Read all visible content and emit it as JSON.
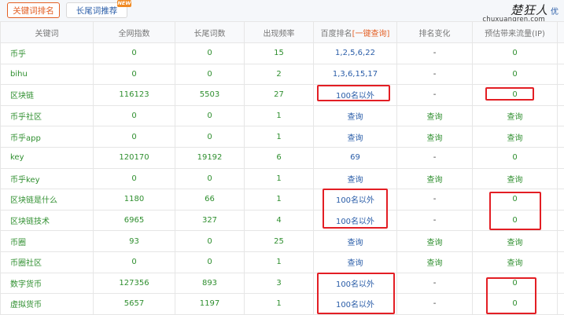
{
  "toolbar": {
    "tab_keywords_rank": "关键词排名",
    "tab_longtail": "长尾词推荐",
    "new_badge": "NEW"
  },
  "watermark": {
    "line1": "楚狂人",
    "line1_suffix": "优",
    "line2": "chuxuangren.com"
  },
  "table": {
    "headers": {
      "keyword": "关键词",
      "index": "全网指数",
      "longtail": "长尾词数",
      "freq": "出现频率",
      "baidu": "百度排名",
      "baidu_action": "[一键查询]",
      "change": "排名变化",
      "traffic": "预估带来流量(IP)"
    },
    "rows": [
      {
        "keyword": "币乎",
        "index": "0",
        "longtail": "0",
        "freq": "15",
        "baidu": "1,2,5,6,22",
        "change": "-",
        "traffic": "0"
      },
      {
        "keyword": "bihu",
        "index": "0",
        "longtail": "0",
        "freq": "2",
        "baidu": "1,3,6,15,17",
        "change": "-",
        "traffic": "0"
      },
      {
        "keyword": "区块链",
        "index": "116123",
        "longtail": "5503",
        "freq": "27",
        "baidu": "100名以外",
        "change": "-",
        "traffic": "0"
      },
      {
        "keyword": "币乎社区",
        "index": "0",
        "longtail": "0",
        "freq": "1",
        "baidu": "查询",
        "change": "查询",
        "traffic": "查询"
      },
      {
        "keyword": "币乎app",
        "index": "0",
        "longtail": "0",
        "freq": "1",
        "baidu": "查询",
        "change": "查询",
        "traffic": "查询"
      },
      {
        "keyword": "key",
        "index": "120170",
        "longtail": "19192",
        "freq": "6",
        "baidu": "69",
        "change": "-",
        "traffic": "0"
      },
      {
        "keyword": "币乎key",
        "index": "0",
        "longtail": "0",
        "freq": "1",
        "baidu": "查询",
        "change": "查询",
        "traffic": "查询"
      },
      {
        "keyword": "区块链是什么",
        "index": "1180",
        "longtail": "66",
        "freq": "1",
        "baidu": "100名以外",
        "change": "-",
        "traffic": "0"
      },
      {
        "keyword": "区块链技术",
        "index": "6965",
        "longtail": "327",
        "freq": "4",
        "baidu": "100名以外",
        "change": "-",
        "traffic": "0"
      },
      {
        "keyword": "币圈",
        "index": "93",
        "longtail": "0",
        "freq": "25",
        "baidu": "查询",
        "change": "查询",
        "traffic": "查询"
      },
      {
        "keyword": "币圈社区",
        "index": "0",
        "longtail": "0",
        "freq": "1",
        "baidu": "查询",
        "change": "查询",
        "traffic": "查询"
      },
      {
        "keyword": "数字货币",
        "index": "127356",
        "longtail": "893",
        "freq": "3",
        "baidu": "100名以外",
        "change": "-",
        "traffic": "0"
      },
      {
        "keyword": "虚拟货币",
        "index": "5657",
        "longtail": "1197",
        "freq": "1",
        "baidu": "100名以外",
        "change": "-",
        "traffic": "0"
      }
    ]
  },
  "colors": {
    "accent": "#e35f24",
    "link": "#2a5da8",
    "keyword_green": "#2f8f2f",
    "annotation_red": "#e31e24"
  }
}
